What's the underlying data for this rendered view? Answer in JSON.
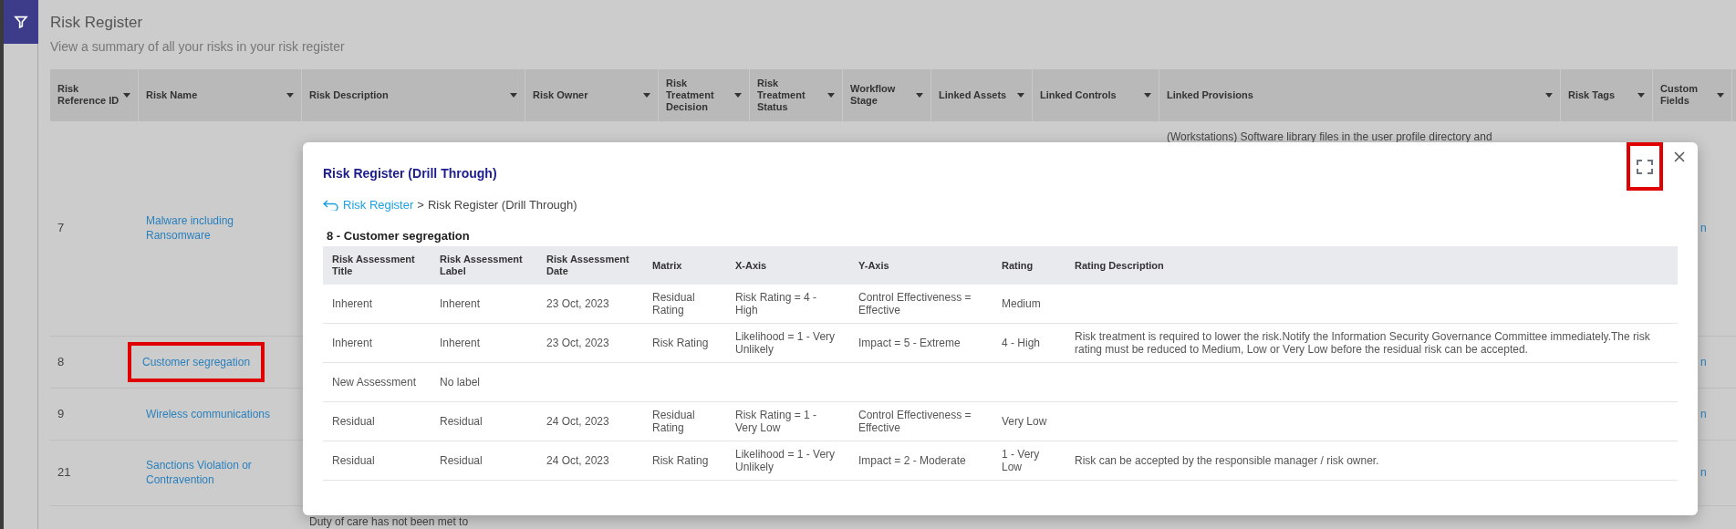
{
  "page": {
    "title": "Risk Register",
    "subtitle": "View a summary of all your risks in your risk register"
  },
  "table": {
    "columns": [
      "Risk Reference ID",
      "Risk Name",
      "Risk Description",
      "Risk Owner",
      "Risk Treatment Decision",
      "Risk Treatment Status",
      "Workflow Stage",
      "Linked Assets",
      "Linked Controls",
      "Linked Provisions",
      "Risk Tags",
      "Custom Fields"
    ],
    "rows": [
      {
        "ref": "7",
        "name": "Malware including Ransomware",
        "highlighted": false,
        "provisions": "(Workstations) Software library files in the user profile directory and",
        "custom": "n"
      },
      {
        "ref": "8",
        "name": "Customer segregation",
        "highlighted": true,
        "custom": "n"
      },
      {
        "ref": "9",
        "name": "Wireless communications",
        "highlighted": false,
        "custom": "n"
      },
      {
        "ref": "21",
        "name": "Sanctions Violation or Contravention",
        "highlighted": false,
        "custom": "n"
      },
      {
        "description": "Duty of care has not been met to"
      }
    ]
  },
  "modal": {
    "title": "Risk Register (Drill Through)",
    "expand_highlighted": true,
    "breadcrumb": {
      "link": "Risk Register",
      "separator": ">",
      "current": "Risk Register (Drill Through)"
    },
    "heading": "8 - Customer segregation",
    "columns": [
      "Risk Assessment Title",
      "Risk Assessment Label",
      "Risk Assessment Date",
      "Matrix",
      "X-Axis",
      "Y-Axis",
      "Rating",
      "Rating Description"
    ],
    "rows": [
      [
        "Inherent",
        "Inherent",
        "23 Oct, 2023",
        "Residual Rating",
        "Risk Rating = 4 - High",
        "Control Effectiveness = Effective",
        "Medium",
        null
      ],
      [
        "Inherent",
        "Inherent",
        "23 Oct, 2023",
        "Risk Rating",
        "Likelihood = 1 - Very Unlikely",
        "Impact = 5 - Extreme",
        "4 - High",
        "Risk treatment is required to lower the risk.Notify the Information Security Governance Committee immediately.The risk rating must be reduced to Medium, Low or Very Low before the residual risk can be accepted."
      ],
      [
        "New Assessment",
        "No label",
        null,
        null,
        null,
        null,
        null,
        null
      ],
      [
        "Residual",
        "Residual",
        "24 Oct, 2023",
        "Residual Rating",
        "Risk Rating = 1 - Very Low",
        "Control Effectiveness = Effective",
        "Very Low",
        null
      ],
      [
        "Residual",
        "Residual",
        "24 Oct, 2023",
        "Risk Rating",
        "Likelihood = 1 - Very Unlikely",
        "Impact = 2 - Moderate",
        "1 - Very Low",
        "Risk can be accepted by the responsible manager / risk owner."
      ]
    ]
  }
}
